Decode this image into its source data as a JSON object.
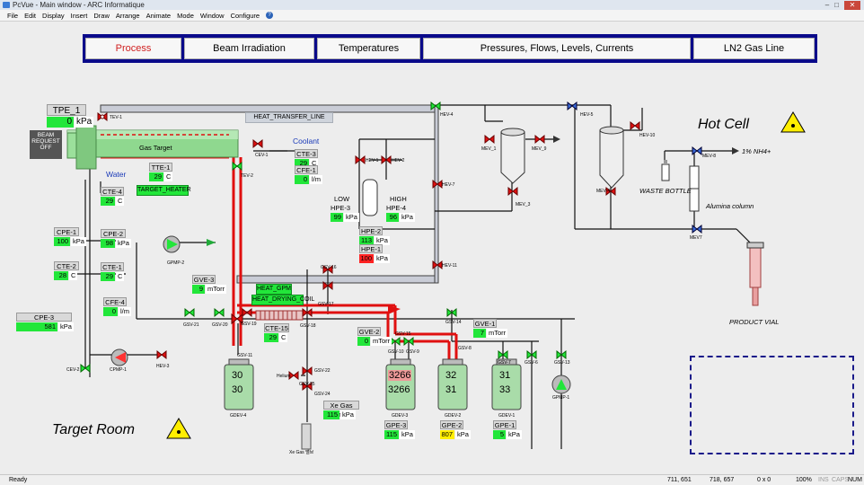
{
  "window": {
    "title": "PcVue - Main window - ARC Informatique",
    "min": "–",
    "max": "□",
    "close": "✕"
  },
  "menu": [
    "File",
    "Edit",
    "Display",
    "Insert",
    "Draw",
    "Arrange",
    "Animate",
    "Mode",
    "Window",
    "Configure"
  ],
  "help_icon": "?",
  "nav": [
    {
      "label": "Process",
      "active": true
    },
    {
      "label": "Beam Irradiation"
    },
    {
      "label": "Temperatures"
    },
    {
      "label": "Pressures, Flows, Levels, Currents"
    },
    {
      "label": "LN2 Gas Line"
    }
  ],
  "areas": {
    "hot_cell": "Hot Cell",
    "target_room": "Target Room"
  },
  "tpe": {
    "tag": "TPE_1",
    "value": "0",
    "unit": "kPa"
  },
  "beam_request": "BEAM REQUEST OFF",
  "gas_target": "Gas Target",
  "coolant": "Coolant",
  "water": "Water",
  "heat_transfer_line": "HEAT_TRANSFER_LINE",
  "target_heater": "TARGET_HEATER",
  "heat_gpm": "HEAT_GPM",
  "heat_drying_coil": "HEAT_DRYING_COIL",
  "sensors": {
    "tte1": {
      "tag": "TTE-1",
      "value": "29",
      "unit": "C"
    },
    "cte4": {
      "tag": "CTE-4",
      "value": "29",
      "unit": "C"
    },
    "cte3": {
      "tag": "CTE-3",
      "value": "29",
      "unit": "C"
    },
    "cfe1": {
      "tag": "CFE-1",
      "value": "0",
      "unit": "l/m"
    },
    "cpe1": {
      "tag": "CPE-1",
      "value": "100",
      "unit": "kPa"
    },
    "cpe2": {
      "tag": "CPE-2",
      "value": "98",
      "unit": "kPa"
    },
    "cte2": {
      "tag": "CTE-2",
      "value": "28",
      "unit": "C"
    },
    "cte1": {
      "tag": "CTE-1",
      "value": "29",
      "unit": "C"
    },
    "cfe4": {
      "tag": "CFE-4",
      "value": "0",
      "unit": "l/m"
    },
    "cpe3": {
      "tag": "CPE-3",
      "value": "581",
      "unit": "kPa"
    },
    "gve3": {
      "tag": "GVE-3",
      "value": "9",
      "unit": "mTorr"
    },
    "cte15": {
      "tag": "CTE-15",
      "value": "29",
      "unit": "C"
    },
    "low_hpe3": {
      "tag1": "LOW",
      "tag2": "HPE-3",
      "value": "99",
      "unit": "kPa"
    },
    "high_hpe4": {
      "tag1": "HIGH",
      "tag2": "HPE-4",
      "value": "96",
      "unit": "kPa"
    },
    "hpe2": {
      "tag": "HPE-2",
      "value": "113",
      "unit": "kPa"
    },
    "hpe1": {
      "tag": "HPE-1",
      "value": "100",
      "unit": "kPa"
    },
    "gve2": {
      "tag": "GVE-2",
      "value": "0",
      "unit": "mTorr"
    },
    "gve1": {
      "tag": "GVE-1",
      "value": "7",
      "unit": "mTorr"
    },
    "gpe3": {
      "tag": "GPE-3",
      "value": "115",
      "unit": "kPa"
    },
    "gpe2": {
      "tag": "GPE-2",
      "value": "807",
      "unit": "kPa"
    },
    "gpe1": {
      "tag": "GPE-1",
      "value": "5",
      "unit": "kPa"
    },
    "xe_gas": {
      "tag": "Xe Gas Pres",
      "value": "115",
      "unit": "kPa"
    }
  },
  "tanks": {
    "gdev4": {
      "top": "30",
      "bottom": "30",
      "tag": "GDEV-4"
    },
    "gdev3": {
      "top": "3266",
      "bottom": "3266",
      "tag": "GDEV-3"
    },
    "gdev2": {
      "top": "32",
      "bottom": "31",
      "tag": "GDEV-2"
    },
    "gdev1": {
      "top": "31",
      "bottom": "33",
      "tag": "GDEV-1"
    }
  },
  "valve_tags": {
    "tev1": "TEV-1",
    "cev1": "CEV-1",
    "tev2": "TEV-2",
    "gpmp2": "GPMP-2",
    "gsv21": "GSV-21",
    "gsv20": "GSV-20",
    "gsv19": "GSV-19",
    "gsv18": "GSV-18",
    "gsv17": "GSV-17",
    "gsv16": "GSV-16",
    "gsv15": "GSV-15",
    "gsv14": "GSV-14",
    "gsv13": "GSV-13",
    "gsv9": "GSV-9",
    "gsv8": "GSV-8",
    "gsv7": "GSV-7",
    "gsv6": "GSV-6",
    "gsv25": "GSV-25",
    "gsv22": "GSV-22",
    "gsv24": "GSV-24",
    "gsv10": "GSV-10",
    "gsv11": "GSV-11",
    "gpmp1": "GPMP-1",
    "cpmp1": "CPMP-1",
    "cev2": "CEV-2",
    "hev3": "HEV-3",
    "hev1": "HEV-1",
    "hev2": "HEV-2",
    "hev7": "HEV-7",
    "hev11": "HEV-11",
    "hev8": "HEV-8",
    "hev9": "HEV-9",
    "hev4": "HEV-4",
    "hev5": "HEV-5",
    "hev10": "HEV-10",
    "hev6": "HEV-6",
    "mev1": "MEV_1",
    "mev3": "MEV_3",
    "mev4": "MEV-4",
    "mev5": "MEV_5",
    "mev6": "MEV_6",
    "mev7": "MEV7",
    "mev8": "MEV-8",
    "mev9": "MEV_9",
    "mev10": "MEV_10",
    "mev11": "MEV_11",
    "helium": "Helium",
    "xegas": "Xe Gas 밸브"
  },
  "hotcell_labels": {
    "nh4": "1% NH4+",
    "waste": "WASTE BOTTLE",
    "alumina": "Alumina column",
    "product": "PRODUCT VIAL"
  },
  "status": {
    "ready": "Ready",
    "pos1": "711, 651",
    "pos2": "718, 657",
    "count": "0 x 0",
    "zoom": "100%",
    "ins": "INS",
    "caps": "CAPS",
    "num": "NUM"
  },
  "colors": {
    "nav_bg": "#0a0a8a",
    "active": "#d02020",
    "ok": "#22e63a",
    "alarm": "#ff2222",
    "warn": "#ffee00",
    "flow": "#e01010"
  }
}
